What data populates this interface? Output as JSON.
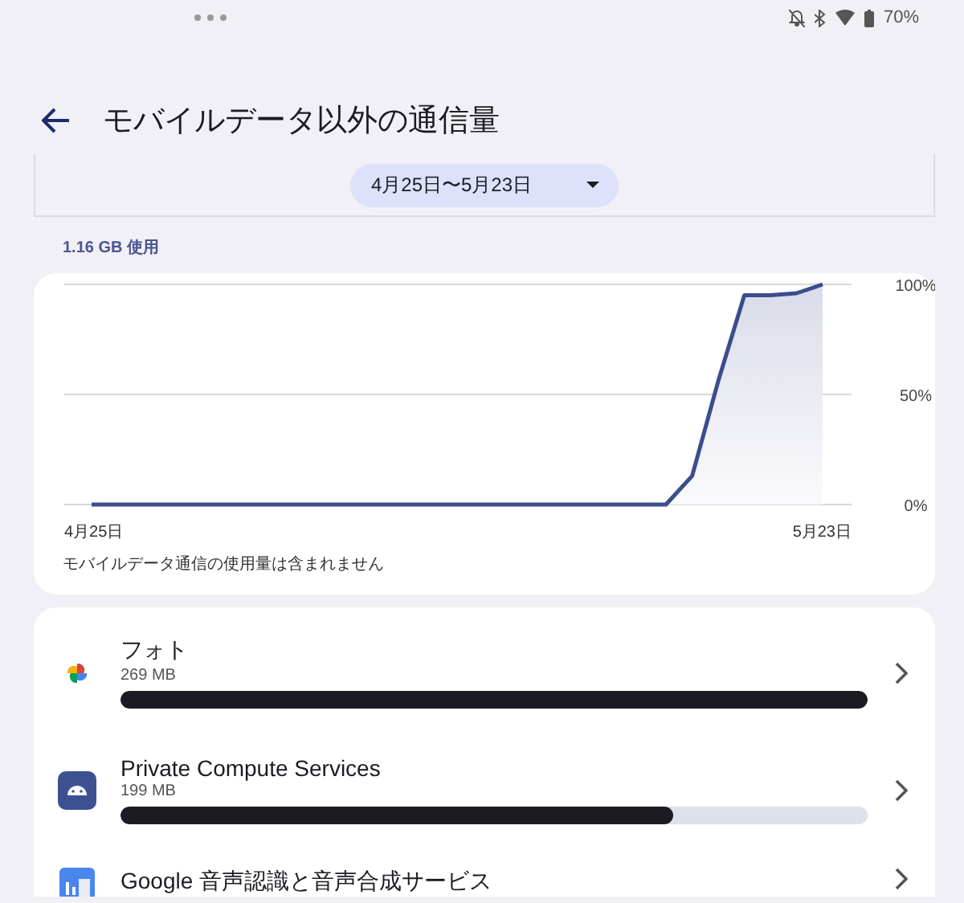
{
  "status_bar": {
    "battery": "70%"
  },
  "header": {
    "title": "モバイルデータ以外の通信量"
  },
  "date_selector": {
    "value": "4月25日〜5月23日"
  },
  "total_usage": "1.16 GB 使用",
  "usage_chart": {
    "chart_data": {
      "type": "area",
      "categories": [
        "4月25日",
        null,
        null,
        null,
        null,
        null,
        null,
        null,
        null,
        null,
        null,
        null,
        null,
        null,
        null,
        null,
        null,
        null,
        null,
        null,
        null,
        null,
        null,
        null,
        null,
        null,
        null,
        null,
        "5月23日"
      ],
      "series": [
        {
          "color": "#3b4d8c",
          "values": [
            0,
            0,
            0,
            0,
            0,
            0,
            0,
            0,
            0,
            0,
            0,
            0,
            0,
            0,
            0,
            0,
            0,
            0,
            0,
            0,
            0,
            0,
            0,
            13,
            56,
            95,
            95,
            96,
            100
          ]
        }
      ],
      "ylim": [
        0,
        100
      ],
      "yticks": [
        {
          "value": 0,
          "label": "0%"
        },
        {
          "value": 50,
          "label": "50%"
        },
        {
          "value": 100,
          "label": "100%"
        }
      ]
    },
    "note": "モバイルデータ通信の使用量は含まれません"
  },
  "apps": [
    {
      "kind": "photos",
      "name": "フォト",
      "usage": "269 MB",
      "level": 1
    },
    {
      "kind": "android",
      "name": "Private Compute Services",
      "usage": "199 MB",
      "level": 0.74
    },
    {
      "kind": "speech",
      "name": "Google 音声認識と音声合成サービス"
    }
  ]
}
